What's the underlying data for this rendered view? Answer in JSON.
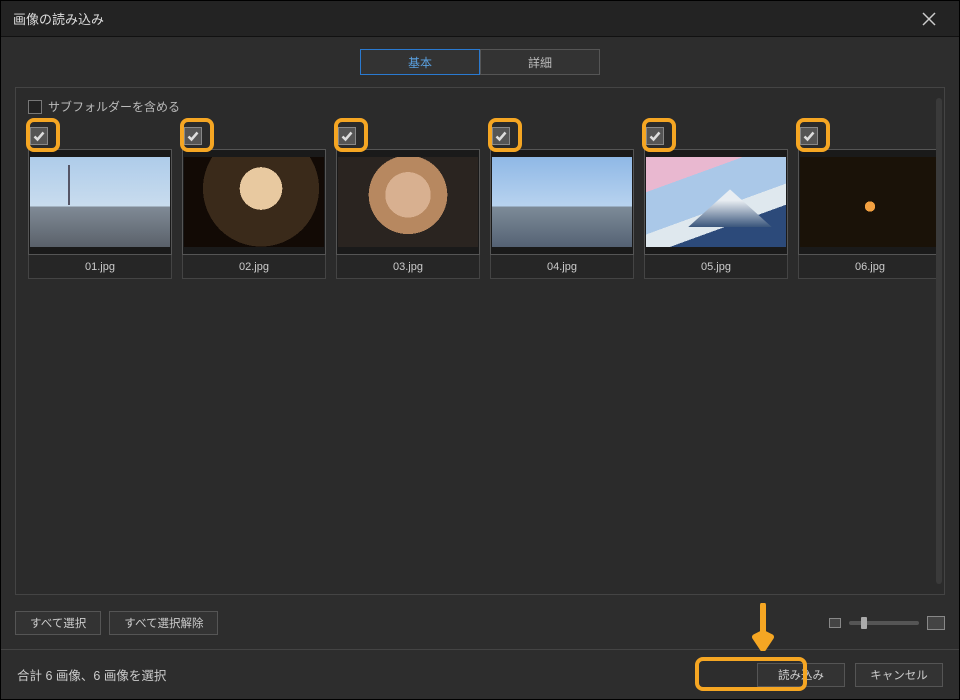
{
  "window": {
    "title": "画像の読み込み"
  },
  "tabs": {
    "basic": "基本",
    "advanced": "詳細"
  },
  "options": {
    "include_subfolders": "サブフォルダーを含める"
  },
  "thumbs": [
    {
      "name": "01.jpg"
    },
    {
      "name": "02.jpg"
    },
    {
      "name": "03.jpg"
    },
    {
      "name": "04.jpg"
    },
    {
      "name": "05.jpg"
    },
    {
      "name": "06.jpg"
    }
  ],
  "buttons": {
    "select_all": "すべて選択",
    "deselect_all": "すべて選択解除",
    "import": "読み込み",
    "cancel": "キャンセル"
  },
  "status": "合計 6 画像、6 画像を選択",
  "colors": {
    "accent": "#2a7ad1",
    "highlight": "#f5a623"
  }
}
